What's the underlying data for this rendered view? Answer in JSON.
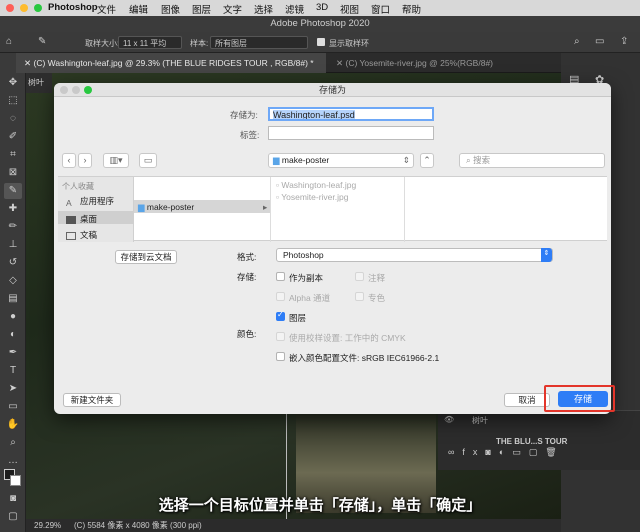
{
  "menubar": {
    "app_name": "Photoshop",
    "items": [
      "文件",
      "编辑",
      "图像",
      "图层",
      "文字",
      "选择",
      "滤镜",
      "3D",
      "视图",
      "窗口",
      "帮助"
    ]
  },
  "window": {
    "title": "Adobe Photoshop 2020"
  },
  "options_bar": {
    "sample_size_label": "取样大小:",
    "sample_size_value": "11 x 11 平均",
    "sample_label": "样本:",
    "sample_value": "所有图层",
    "show_ring_label": "显示取样环"
  },
  "tabs": [
    {
      "label": "(C) Washington-leaf.jpg @ 29.3% (THE BLUE RIDGES TOUR , RGB/8#) *",
      "active": true
    },
    {
      "label": "(C) Yosemite-river.jpg @ 25%(RGB/8#)",
      "active": false
    }
  ],
  "left_panel_stub": "树叶",
  "dialog": {
    "title": "存储为",
    "save_as_label": "存储为:",
    "save_as_value": "Washington-leaf.psd",
    "tags_label": "标签:",
    "tags_value": "",
    "location": "make-poster",
    "search_placeholder": "搜索",
    "sidebar": {
      "section": "个人收藏",
      "items": [
        "应用程序",
        "桌面",
        "文稿"
      ]
    },
    "column1": [
      "make-poster"
    ],
    "column2": [
      "Washington-leaf.jpg",
      "Yosemite-river.jpg"
    ],
    "save_to_cloud": "存储到云文档",
    "format_label": "格式:",
    "format_value": "Photoshop",
    "save_label": "存储:",
    "options": [
      {
        "label": "作为副本",
        "checked": false,
        "enabled": true
      },
      {
        "label": "注释",
        "checked": false,
        "enabled": false
      },
      {
        "label": "Alpha 通道",
        "checked": false,
        "enabled": false
      },
      {
        "label": "专色",
        "checked": false,
        "enabled": false
      },
      {
        "label": "图层",
        "checked": true,
        "enabled": true
      }
    ],
    "color_label": "颜色:",
    "proof_setup": "使用校样设置: 工作中的 CMYK",
    "embed_profile": "嵌入颜色配置文件: sRGB IEC61966-2.1",
    "new_folder": "新建文件夹",
    "cancel": "取消",
    "save": "存储"
  },
  "layers_panel": {
    "items": [
      "树叶",
      "THE BLU...S TOUR"
    ]
  },
  "status": {
    "zoom": "29.29%",
    "doc_info": "(C) 5584 像素 x 4080 像素 (300 ppi)"
  },
  "caption": "选择一个目标位置并单击「存储」，单击「确定」"
}
